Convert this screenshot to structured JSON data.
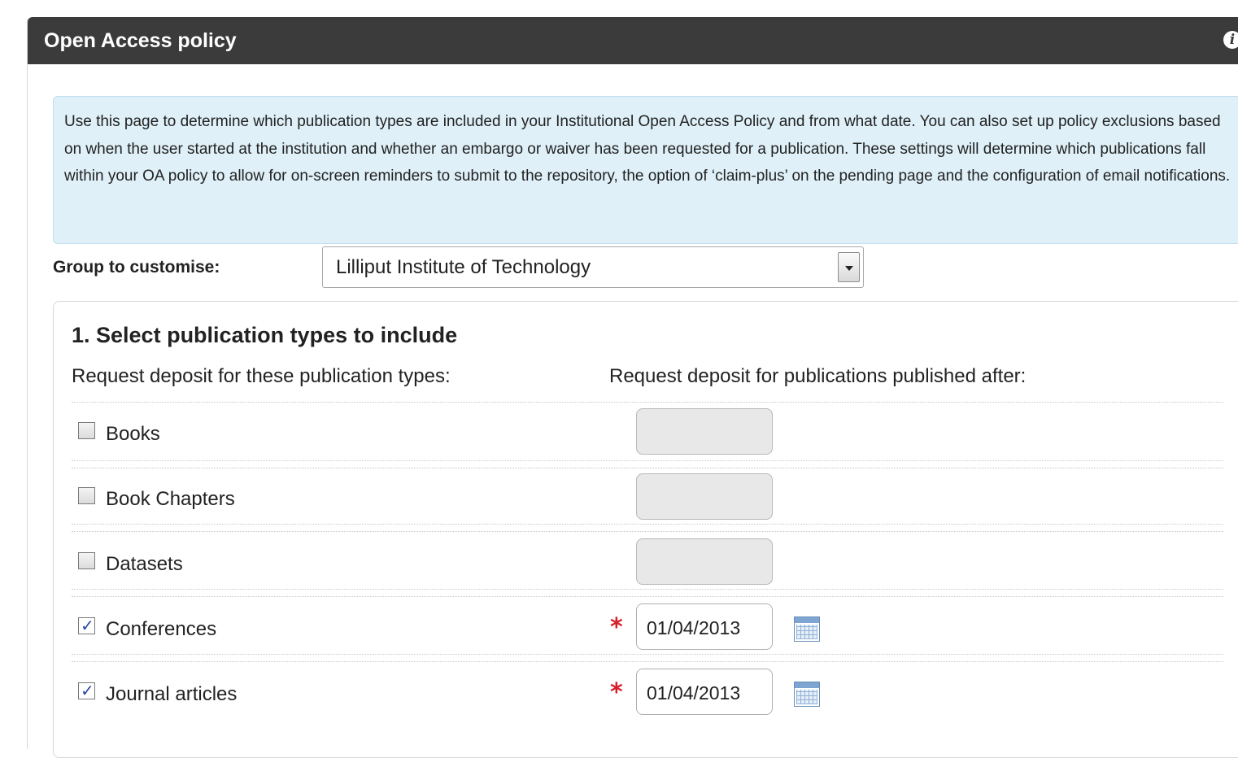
{
  "header": {
    "title": "Open Access policy",
    "info_icon": "info-icon"
  },
  "info": {
    "text": "Use this page to determine which publication types are included in your Institutional Open Access Policy and from what date. You can also set up policy exclusions based on when the user started at the institution and whether an embargo or waiver has been requested for a publication. These settings will determine which publications fall within your OA policy to allow for on-screen reminders to submit to the repository, the option of ‘claim-plus’ on the pending page and the configuration of email notifications."
  },
  "group": {
    "label": "Group to customise:",
    "selected": "Lilliput Institute of Technology"
  },
  "section1": {
    "title": "1. Select publication types to include",
    "col_left": "Request deposit for these publication types:",
    "col_right": "Request deposit for publications published after:",
    "rows": [
      {
        "label": "Books",
        "checked": false,
        "date": ""
      },
      {
        "label": "Book Chapters",
        "checked": false,
        "date": ""
      },
      {
        "label": "Datasets",
        "checked": false,
        "date": ""
      },
      {
        "label": "Conferences",
        "checked": true,
        "date": "01/04/2013",
        "required": "*"
      },
      {
        "label": "Journal articles",
        "checked": true,
        "date": "01/04/2013",
        "required": "*"
      }
    ]
  },
  "colors": {
    "header_bg": "#3b3b3b",
    "info_bg": "#dff0f8",
    "required": "#d6202a"
  }
}
